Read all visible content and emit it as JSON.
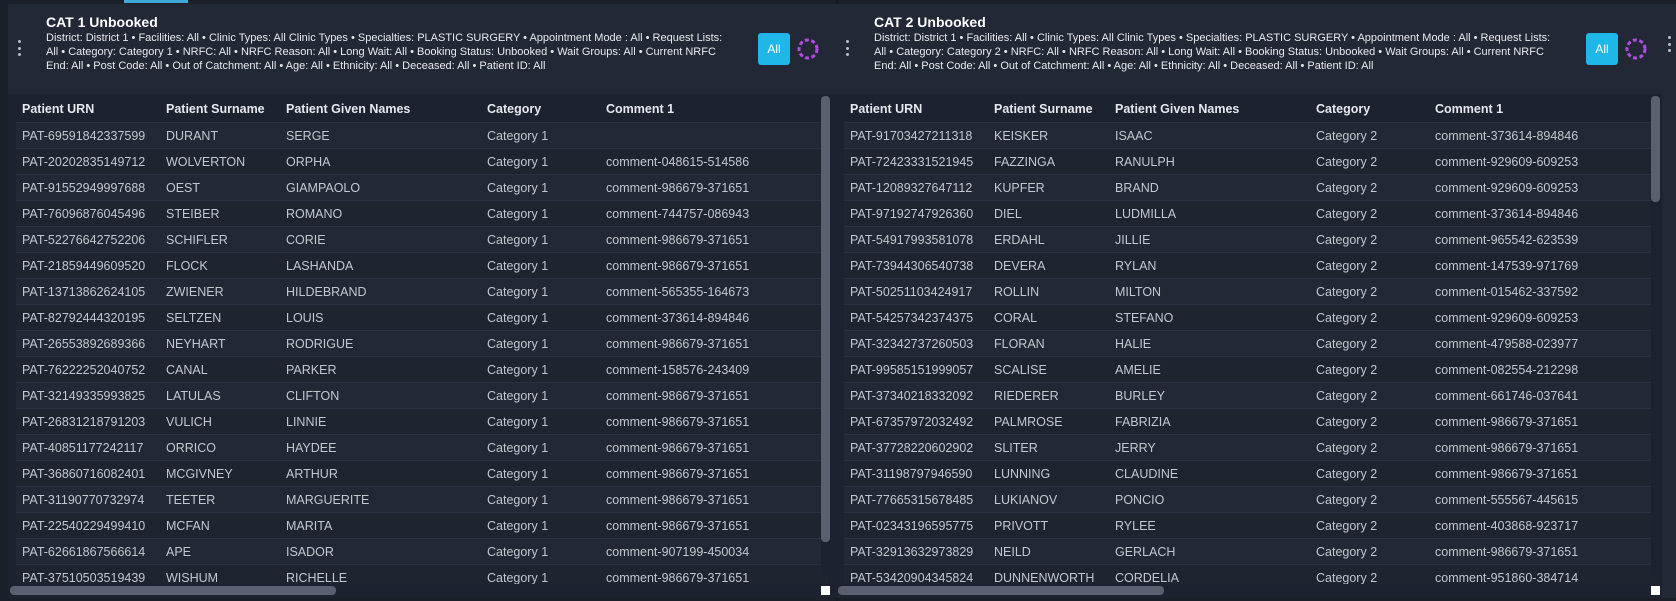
{
  "panels": [
    {
      "title": "CAT 1 Unbooked",
      "filters": "District: District 1  •  Facilities: All  •  Clinic Types: All Clinic Types  •  Specialties: PLASTIC SURGERY  •  Appointment Mode : All  •  Request Lists: All  •  Category: Category 1  •  NRFC: All  •  NRFC Reason: All  •  Long Wait: All  •  Booking Status: Unbooked  •  Wait Groups: All  •  Current NRFC End: All  •  Post Code: All  •  Out of Catchment: All  •  Age: All  •  Ethnicity: All  •  Deceased: All  •  Patient ID: All",
      "all_label": "All",
      "columns": [
        "Patient URN",
        "Patient Surname",
        "Patient Given Names",
        "Category",
        "Comment 1"
      ],
      "rows": [
        [
          "PAT-69591842337599",
          "DURANT",
          "SERGE",
          "Category 1",
          ""
        ],
        [
          "PAT-20202835149712",
          "WOLVERTON",
          "ORPHA",
          "Category 1",
          "comment-048615-514586"
        ],
        [
          "PAT-91552949997688",
          "OEST",
          "GIAMPAOLO",
          "Category 1",
          "comment-986679-371651"
        ],
        [
          "PAT-76096876045496",
          "STEIBER",
          "ROMANO",
          "Category 1",
          "comment-744757-086943"
        ],
        [
          "PAT-52276642752206",
          "SCHIFLER",
          "CORIE",
          "Category 1",
          "comment-986679-371651"
        ],
        [
          "PAT-21859449609520",
          "FLOCK",
          "LASHANDA",
          "Category 1",
          "comment-986679-371651"
        ],
        [
          "PAT-13713862624105",
          "ZWIENER",
          "HILDEBRAND",
          "Category 1",
          "comment-565355-164673"
        ],
        [
          "PAT-82792444320195",
          "SELTZEN",
          "LOUIS",
          "Category 1",
          "comment-373614-894846"
        ],
        [
          "PAT-26553892689366",
          "NEYHART",
          "RODRIGUE",
          "Category 1",
          "comment-986679-371651"
        ],
        [
          "PAT-76222252040752",
          "CANAL",
          "PARKER",
          "Category 1",
          "comment-158576-243409"
        ],
        [
          "PAT-32149335993825",
          "LATULAS",
          "CLIFTON",
          "Category 1",
          "comment-986679-371651"
        ],
        [
          "PAT-26831218791203",
          "VULICH",
          "LINNIE",
          "Category 1",
          "comment-986679-371651"
        ],
        [
          "PAT-40851177242117",
          "ORRICO",
          "HAYDEE",
          "Category 1",
          "comment-986679-371651"
        ],
        [
          "PAT-36860716082401",
          "MCGIVNEY",
          "ARTHUR",
          "Category 1",
          "comment-986679-371651"
        ],
        [
          "PAT-31190770732974",
          "TEETER",
          "MARGUERITE",
          "Category 1",
          "comment-986679-371651"
        ],
        [
          "PAT-22540229499410",
          "MCFAN",
          "MARITA",
          "Category 1",
          "comment-986679-371651"
        ],
        [
          "PAT-62661867566614",
          "APE",
          "ISADOR",
          "Category 1",
          "comment-907199-450034"
        ],
        [
          "PAT-37510503519439",
          "WISHUM",
          "RICHELLE",
          "Category 1",
          "comment-986679-371651"
        ]
      ]
    },
    {
      "title": "CAT 2 Unbooked",
      "filters": "District: District 1  •  Facilities: All  •  Clinic Types: All Clinic Types  •  Specialties: PLASTIC SURGERY  •  Appointment Mode : All  •  Request Lists: All  •  Category: Category 2  •  NRFC: All  •  NRFC Reason: All  •  Long Wait: All  •  Booking Status: Unbooked  •  Wait Groups: All  •  Current NRFC End: All  •  Post Code: All  •  Out of Catchment: All  •  Age: All  •  Ethnicity: All  •  Deceased: All  •  Patient ID: All",
      "all_label": "All",
      "columns": [
        "Patient URN",
        "Patient Surname",
        "Patient Given Names",
        "Category",
        "Comment 1"
      ],
      "rows": [
        [
          "PAT-91703427211318",
          "KEISKER",
          "ISAAC",
          "Category 2",
          "comment-373614-894846"
        ],
        [
          "PAT-72423331521945",
          "FAZZINGA",
          "RANULPH",
          "Category 2",
          "comment-929609-609253"
        ],
        [
          "PAT-12089327647112",
          "KUPFER",
          "BRAND",
          "Category 2",
          "comment-929609-609253"
        ],
        [
          "PAT-97192747926360",
          "DIEL",
          "LUDMILLA",
          "Category 2",
          "comment-373614-894846"
        ],
        [
          "PAT-54917993581078",
          "ERDAHL",
          "JILLIE",
          "Category 2",
          "comment-965542-623539"
        ],
        [
          "PAT-73944306540738",
          "DEVERA",
          "RYLAN",
          "Category 2",
          "comment-147539-971769"
        ],
        [
          "PAT-50251103424917",
          "ROLLIN",
          "MILTON",
          "Category 2",
          "comment-015462-337592"
        ],
        [
          "PAT-54257342374375",
          "CORAL",
          "STEFANO",
          "Category 2",
          "comment-929609-609253"
        ],
        [
          "PAT-32342737260503",
          "FLORAN",
          "HALIE",
          "Category 2",
          "comment-479588-023977"
        ],
        [
          "PAT-99585151999057",
          "SCALISE",
          "AMELIE",
          "Category 2",
          "comment-082554-212298"
        ],
        [
          "PAT-37340218332092",
          "RIEDERER",
          "BURLEY",
          "Category 2",
          "comment-661746-037641"
        ],
        [
          "PAT-67357972032492",
          "PALMROSE",
          "FABRIZIA",
          "Category 2",
          "comment-986679-371651"
        ],
        [
          "PAT-37728220602902",
          "SLITER",
          "JERRY",
          "Category 2",
          "comment-986679-371651"
        ],
        [
          "PAT-31198797946590",
          "LUNNING",
          "CLAUDINE",
          "Category 2",
          "comment-986679-371651"
        ],
        [
          "PAT-77665315678485",
          "LUKIANOV",
          "PONCIO",
          "Category 2",
          "comment-555567-445615"
        ],
        [
          "PAT-02343196595775",
          "PRIVOTT",
          "RYLEE",
          "Category 2",
          "comment-403868-923717"
        ],
        [
          "PAT-32913632973829",
          "NEILD",
          "GERLACH",
          "Category 2",
          "comment-986679-371651"
        ],
        [
          "PAT-53420904345824",
          "DUNNENWORTH",
          "CORDELIA",
          "Category 2",
          "comment-951860-384714"
        ]
      ]
    }
  ],
  "scroll": {
    "panel_1": {
      "vertical_visible_fraction": 0.93,
      "horizontal_visible_fraction": 0.4
    },
    "panel_2": {
      "vertical_visible_fraction": 0.22,
      "horizontal_visible_fraction": 0.4
    }
  },
  "colors": {
    "accent": "#1fb6e8",
    "spinner": "#b04de0",
    "background": "#1b1f2a"
  },
  "icons": [
    "kebab-menu-icon",
    "loading-spinner-icon"
  ]
}
